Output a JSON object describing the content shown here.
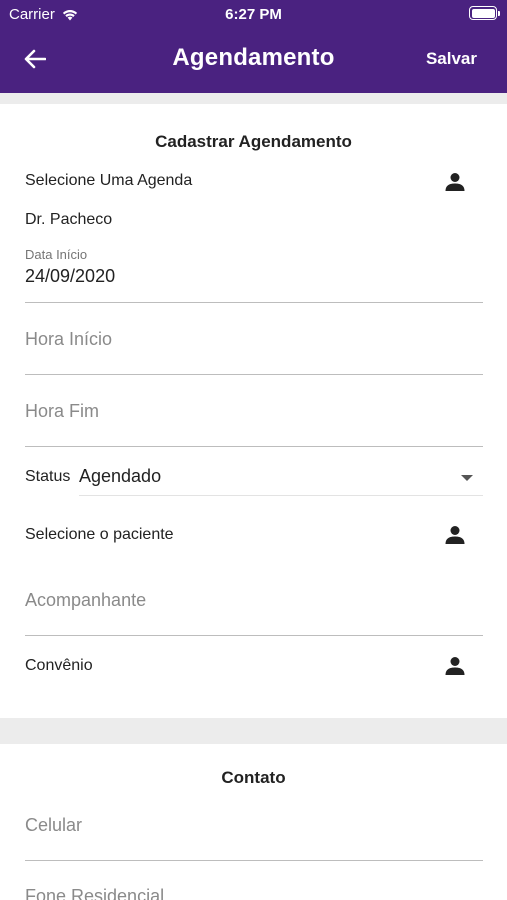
{
  "statusbar": {
    "carrier": "Carrier",
    "time": "6:27 PM"
  },
  "header": {
    "title": "Agendamento",
    "save_label": "Salvar"
  },
  "form": {
    "section_title": "Cadastrar Agendamento",
    "agenda_label": "Selecione Uma Agenda",
    "agenda_value": "Dr. Pacheco",
    "data_inicio_label": "Data Início",
    "data_inicio_value": "24/09/2020",
    "hora_inicio_placeholder": "Hora Início",
    "hora_fim_placeholder": "Hora Fim",
    "status_label": "Status",
    "status_value": "Agendado",
    "paciente_label": "Selecione o paciente",
    "acompanhante_placeholder": "Acompanhante",
    "convenio_label": "Convênio"
  },
  "contato": {
    "section_title": "Contato",
    "celular_placeholder": "Celular",
    "fone_residencial_placeholder": "Fone Residencial"
  },
  "colors": {
    "header": "#4a2280",
    "background": "#ececec",
    "divider": "#bdbdbd"
  }
}
